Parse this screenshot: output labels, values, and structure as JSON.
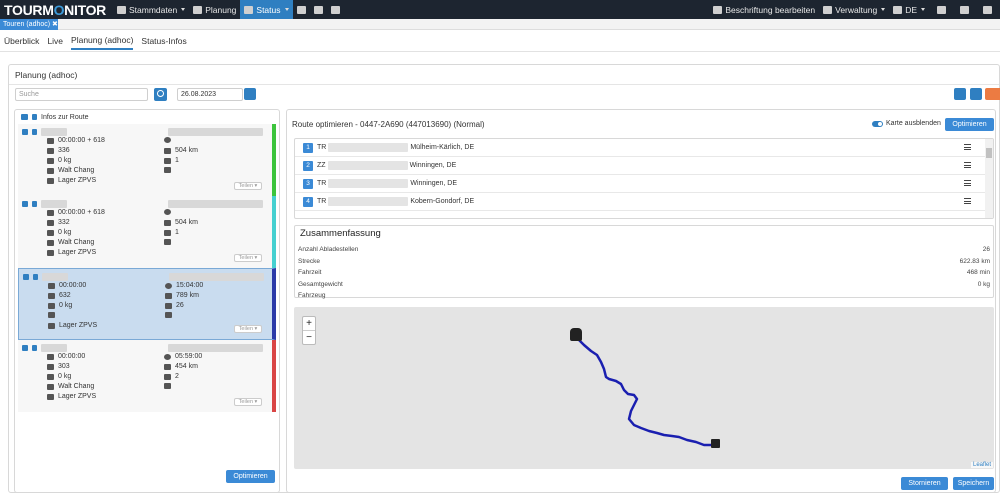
{
  "app": {
    "logo_a": "TOURM",
    "logo_b": "O",
    "logo_c": "NITOR"
  },
  "nav": {
    "items": [
      "Stammdaten",
      "Planung",
      "Status"
    ]
  },
  "navright": {
    "beschriftung": "Beschriftung bearbeiten",
    "verwaltung": "Verwaltung",
    "lang": "DE"
  },
  "doc_tab": "Touren (adhoc)",
  "subnav": [
    "Überblick",
    "Live",
    "Planung (adhoc)",
    "Status-Infos"
  ],
  "card_title": "Planung (adhoc)",
  "search": {
    "placeholder": "Suche",
    "date": "26.08.2023"
  },
  "left": {
    "head": "Infos zur Route",
    "optimize": "Optimieren",
    "teilen": "Teilen",
    "tours": [
      {
        "time": "00:00:00 + 618",
        "count": "336",
        "weight": "0 kg",
        "driver": "Walt Chang",
        "depot": "Lager ZPVS",
        "dist": "504 km",
        "stops": "1",
        "end": "",
        "color": "#3cc43c"
      },
      {
        "time": "00:00:00 + 618",
        "count": "332",
        "weight": "0 kg",
        "driver": "Walt Chang",
        "depot": "Lager ZPVS",
        "dist": "504 km",
        "stops": "1",
        "end": "",
        "color": "#45d0d0"
      },
      {
        "time": "00:00:00",
        "count": "632",
        "weight": "0 kg",
        "driver": "",
        "depot": "Lager ZPVS",
        "dist": "789 km",
        "stops": "26",
        "end": "15:04:00",
        "color": "#2b3aa8"
      },
      {
        "time": "00:00:00",
        "count": "303",
        "weight": "0 kg",
        "driver": "Walt Chang",
        "depot": "Lager ZPVS",
        "dist": "454 km",
        "stops": "2",
        "end": "05:59:00",
        "color": "#d94545"
      }
    ]
  },
  "right": {
    "title": "Route optimieren - 0447-2A690 (447013690) (Normal)",
    "toggle_label": "Karte ausblenden",
    "optimize": "Optimieren",
    "stops": [
      {
        "n": "1",
        "pre": "TR",
        "post": "Mülheim-Kärlich, DE"
      },
      {
        "n": "2",
        "pre": "ZZ",
        "post": "Winningen, DE"
      },
      {
        "n": "3",
        "pre": "TR",
        "post": "Winningen, DE"
      },
      {
        "n": "4",
        "pre": "TR",
        "post": "Kobern-Gondorf, DE"
      }
    ]
  },
  "summary": {
    "title": "Zusammenfassung",
    "rows": [
      {
        "label": "Anzahl Abladestellen",
        "value": "26"
      },
      {
        "label": "Strecke",
        "value": "622.83 km"
      },
      {
        "label": "Fahrzeit",
        "value": "468 min"
      },
      {
        "label": "Gesamtgewicht",
        "value": "0 kg"
      },
      {
        "label": "Fahrzeug",
        "value": ""
      }
    ]
  },
  "map": {
    "zoom_in": "+",
    "zoom_out": "−",
    "attribution": "Leaflet"
  },
  "footer": {
    "stornieren": "Stornieren",
    "speichern": "Speichern"
  },
  "colors": {
    "primary": "#2f7fc1",
    "route": "#1a1fb0",
    "filter": "#ec7b42"
  }
}
